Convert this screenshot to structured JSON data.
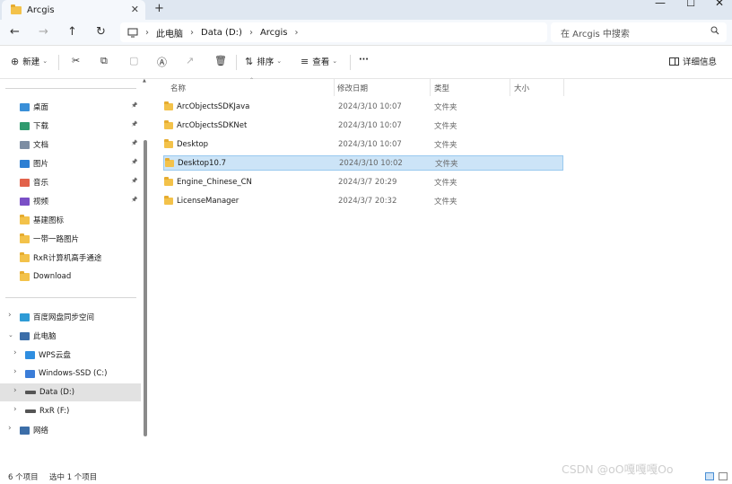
{
  "window": {
    "tab_title": "Arcgis",
    "tab_close": "✕",
    "new_tab": "+",
    "minimize": "—",
    "maximize": "☐",
    "close": "✕"
  },
  "nav": {
    "back": "←",
    "forward": "→",
    "up": "↑",
    "refresh": "↻",
    "breadcrumb": [
      "此电脑",
      "Data (D:)",
      "Arcgis"
    ],
    "search_placeholder": "在 Arcgis 中搜索"
  },
  "toolbar": {
    "new_label": "新建",
    "sort_label": "排序",
    "view_label": "查看",
    "more_label": "···",
    "details_label": "详细信息"
  },
  "sidebar": {
    "quick_access": [
      {
        "label": "桌面",
        "pinned": true,
        "icon": "desktop-icon",
        "color": "#3a8fd8"
      },
      {
        "label": "下载",
        "pinned": true,
        "icon": "download-icon",
        "color": "#2f9a6e"
      },
      {
        "label": "文档",
        "pinned": true,
        "icon": "document-icon",
        "color": "#7d8ea3"
      },
      {
        "label": "图片",
        "pinned": true,
        "icon": "pictures-icon",
        "color": "#2d7fd3"
      },
      {
        "label": "音乐",
        "pinned": true,
        "icon": "music-icon",
        "color": "#e2624a"
      },
      {
        "label": "视频",
        "pinned": true,
        "icon": "video-icon",
        "color": "#7a4fc6"
      },
      {
        "label": "基建图标",
        "pinned": false,
        "icon": "folder-icon",
        "color": "#f3c24a"
      },
      {
        "label": "一带一路图片",
        "pinned": false,
        "icon": "folder-icon",
        "color": "#f3c24a"
      },
      {
        "label": "RxR计算机高手通途",
        "pinned": false,
        "icon": "folder-icon",
        "color": "#f3c24a"
      },
      {
        "label": "Download",
        "pinned": false,
        "icon": "folder-icon",
        "color": "#f3c24a"
      }
    ],
    "tree": [
      {
        "label": "百度网盘同步空间",
        "level": 0,
        "expanded": false,
        "icon": "cloud-sync-icon",
        "color": "#2e9bd6"
      },
      {
        "label": "此电脑",
        "level": 0,
        "expanded": true,
        "icon": "this-pc-icon",
        "color": "#3c6ea8"
      },
      {
        "label": "WPS云盘",
        "level": 1,
        "expanded": false,
        "icon": "wps-cloud-icon",
        "color": "#2f8ee0"
      },
      {
        "label": "Windows-SSD (C:)",
        "level": 1,
        "expanded": false,
        "icon": "windows-drive-icon",
        "color": "#3b7dd8"
      },
      {
        "label": "Data (D:)",
        "level": 1,
        "expanded": false,
        "icon": "drive-icon",
        "color": "#555555",
        "selected": true
      },
      {
        "label": "RxR (F:)",
        "level": 1,
        "expanded": false,
        "icon": "drive-icon",
        "color": "#555555"
      },
      {
        "label": "网络",
        "level": 0,
        "expanded": false,
        "icon": "network-icon",
        "color": "#3c6ea8"
      }
    ]
  },
  "columns": {
    "name": "名称",
    "date": "修改日期",
    "type": "类型",
    "size": "大小"
  },
  "files": [
    {
      "name": "ArcObjectsSDKJava",
      "date": "2024/3/10 10:07",
      "type": "文件夹",
      "selected": false
    },
    {
      "name": "ArcObjectsSDKNet",
      "date": "2024/3/10 10:07",
      "type": "文件夹",
      "selected": false
    },
    {
      "name": "Desktop",
      "date": "2024/3/10 10:07",
      "type": "文件夹",
      "selected": false
    },
    {
      "name": "Desktop10.7",
      "date": "2024/3/10 10:02",
      "type": "文件夹",
      "selected": true
    },
    {
      "name": "Engine_Chinese_CN",
      "date": "2024/3/7 20:29",
      "type": "文件夹",
      "selected": false
    },
    {
      "name": "LicenseManager",
      "date": "2024/3/7 20:32",
      "type": "文件夹",
      "selected": false
    }
  ],
  "status": {
    "count": "6 个项目",
    "selection": "选中 1 个项目"
  },
  "watermark": "CSDN @oO嘎嘎嘎Oo"
}
